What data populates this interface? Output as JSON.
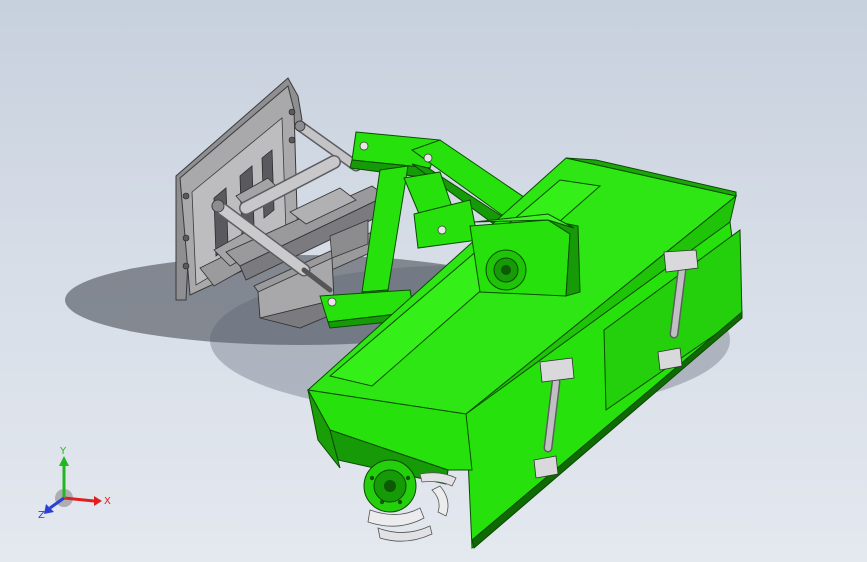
{
  "viewport": {
    "background_top": "#c7d0dd",
    "background_bottom": "#e4e8ef"
  },
  "model": {
    "tiller_color": "#27e10d",
    "tiller_dark": "#169a07",
    "frame_color": "#a9a9ab",
    "frame_dark": "#6f6f73",
    "cylinder_color": "#b8b8bb",
    "blade_color": "#ececef"
  },
  "triad": {
    "x_label": "X",
    "y_label": "Y",
    "z_label": "Z",
    "x_color": "#e02020",
    "y_color": "#22b622",
    "z_color": "#2a3fd6"
  }
}
